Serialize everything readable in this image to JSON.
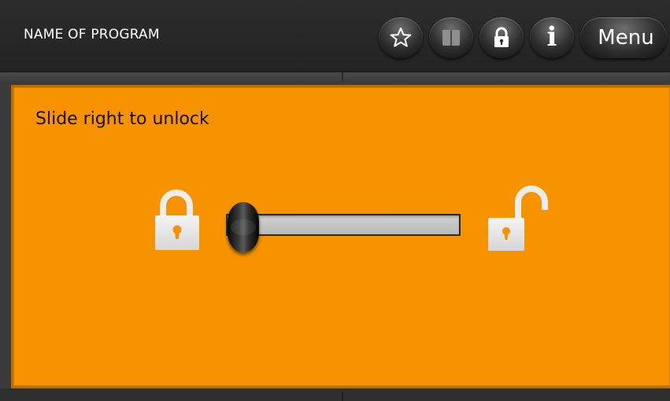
{
  "header": {
    "title": "NAME OF PROGRAM",
    "buttons": [
      {
        "icon": "star-icon"
      },
      {
        "icon": "book-icon"
      },
      {
        "icon": "lock-icon"
      },
      {
        "icon": "info-icon",
        "glyph": "i"
      }
    ],
    "menu_label": "Menu"
  },
  "panel": {
    "instruction": "Slide right to unlock",
    "slider": {
      "value": 0,
      "left_icon": "lock-closed-icon",
      "right_icon": "lock-open-icon"
    }
  },
  "colors": {
    "panel_background": "#f79300",
    "header_background": "#2a2a2a",
    "track": "#c2c4c3",
    "handle": "#1a1a1a"
  }
}
